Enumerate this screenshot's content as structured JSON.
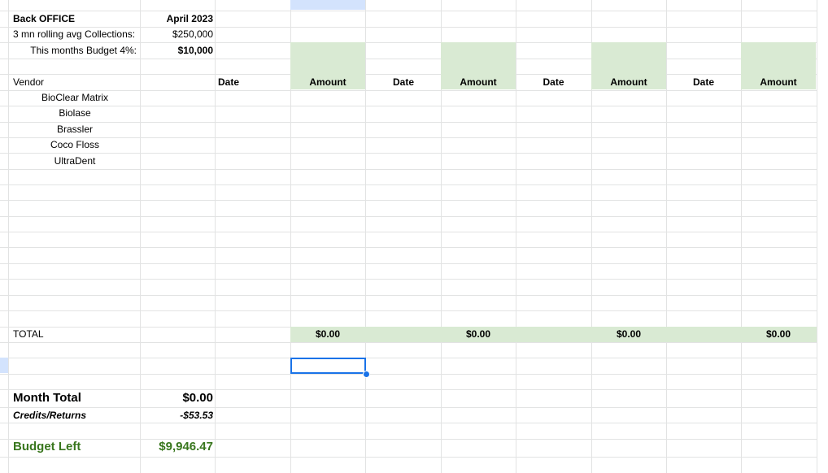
{
  "header": {
    "title": "Back OFFICE",
    "month": "April 2023",
    "collections_label": "3 mn rolling avg Collections:",
    "collections_value": "$250,000",
    "budget_label": "This months Budget 4%:",
    "budget_value": "$10,000"
  },
  "table_header": {
    "vendor": "Vendor",
    "date": "Date",
    "amount": "Amount"
  },
  "vendors": [
    "BioClear Matrix",
    "Biolase",
    "Brassler",
    "Coco Floss",
    "UltraDent"
  ],
  "total": {
    "label": "TOTAL",
    "amounts": [
      "$0.00",
      "$0.00",
      "$0.00",
      "$0.00"
    ]
  },
  "summary": {
    "month_total_label": "Month Total",
    "month_total_value": "$0.00",
    "credits_label": "Credits/Returns",
    "credits_value": "-$53.53",
    "budget_left_label": "Budget Left",
    "budget_left_value": "$9,946.47"
  },
  "colors": {
    "green_fill": "#d9ead3",
    "budget_left_text": "#38761d",
    "selection": "#1a73e8",
    "gridline": "#e2e3e3"
  }
}
